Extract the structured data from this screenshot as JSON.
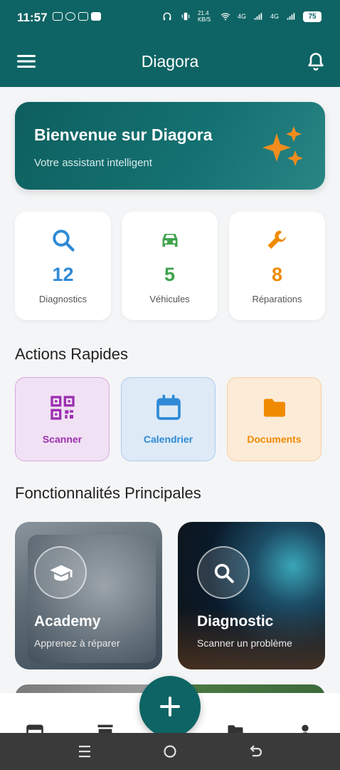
{
  "status_bar": {
    "time": "11:57",
    "net_speed": "21.4 KB/S",
    "network_1": "4G",
    "network_2": "4G",
    "battery": "75"
  },
  "app_bar": {
    "title": "Diagora"
  },
  "welcome": {
    "title": "Bienvenue sur Diagora",
    "subtitle": "Votre assistant intelligent"
  },
  "stats": [
    {
      "value": "12",
      "label": "Diagnostics",
      "color": "#2e8ad6",
      "icon": "search-icon"
    },
    {
      "value": "5",
      "label": "Véhicules",
      "color": "#3fa34d",
      "icon": "car-icon"
    },
    {
      "value": "8",
      "label": "Réparations",
      "color": "#f08a00",
      "icon": "wrench-icon"
    }
  ],
  "sections": {
    "quick_actions": "Actions Rapides",
    "main_features": "Fonctionnalités Principales"
  },
  "quick_actions": [
    {
      "label": "Scanner",
      "color": "#9c2fb0",
      "bg": "#f1e1f4",
      "border": "#d9a8e2",
      "icon": "qr-code-icon"
    },
    {
      "label": "Calendrier",
      "color": "#2e8ad6",
      "bg": "#deeaf6",
      "border": "#aacdee",
      "icon": "calendar-icon"
    },
    {
      "label": "Documents",
      "color": "#f08a00",
      "bg": "#fcebd7",
      "border": "#f5cf9f",
      "icon": "folder-icon"
    }
  ],
  "features": [
    {
      "title": "Academy",
      "subtitle": "Apprenez à réparer",
      "icon": "graduation-cap-icon"
    },
    {
      "title": "Diagnostic",
      "subtitle": "Scanner un problème",
      "icon": "search-icon"
    }
  ],
  "colors": {
    "primary": "#0e6464",
    "accent": "#f28c1c"
  }
}
